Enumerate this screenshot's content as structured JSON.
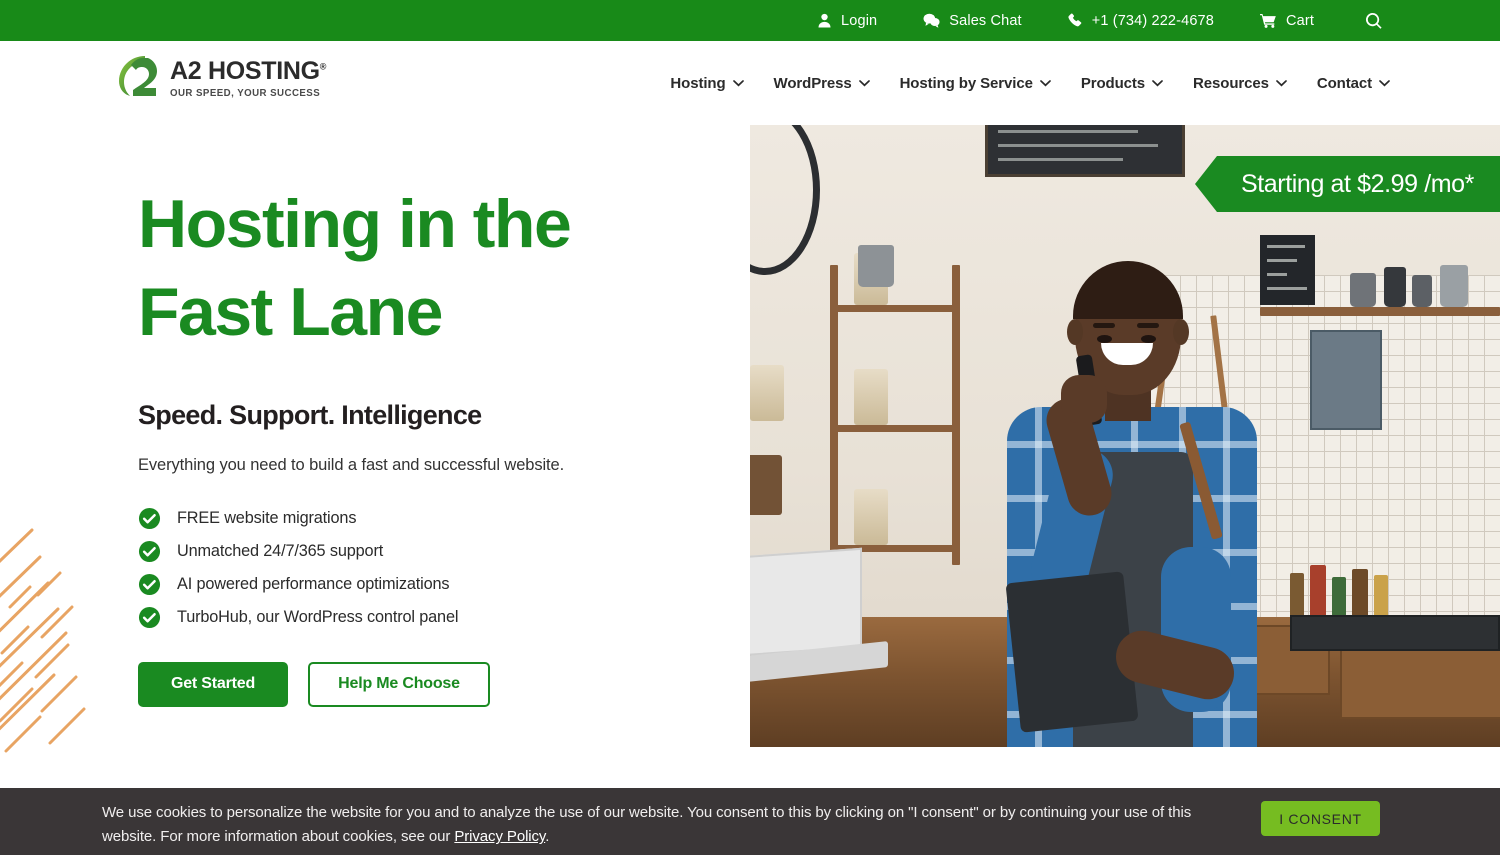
{
  "topbar": {
    "items": [
      {
        "label": "Login",
        "icon": "user-icon"
      },
      {
        "label": "Sales Chat",
        "icon": "chat-icon"
      },
      {
        "label": "+1 (734) 222-4678",
        "icon": "phone-icon"
      },
      {
        "label": "Cart",
        "icon": "cart-icon"
      }
    ],
    "search_icon": "search-icon"
  },
  "logo": {
    "mark": "a2-logo-mark",
    "name_bold": "A2",
    "name_rest": " HOSTING",
    "registered": "®",
    "tagline": "OUR SPEED, YOUR SUCCESS"
  },
  "nav": {
    "items": [
      {
        "label": "Hosting"
      },
      {
        "label": "WordPress"
      },
      {
        "label": "Hosting by Service"
      },
      {
        "label": "Products"
      },
      {
        "label": "Resources"
      },
      {
        "label": "Contact"
      }
    ]
  },
  "hero": {
    "heading_line1": "Hosting in the",
    "heading_line2": "Fast Lane",
    "subheading": "Speed. Support. Intelligence",
    "description": "Everything you need to build a fast and successful website.",
    "features": [
      {
        "label": "FREE website migrations"
      },
      {
        "label": "Unmatched 24/7/365 support"
      },
      {
        "label": "AI powered performance optimizations"
      },
      {
        "label": "TurboHub, our WordPress control panel"
      }
    ],
    "primary_cta": "Get Started",
    "secondary_cta": "Help Me Choose",
    "price_badge": "Starting at $2.99 /mo*",
    "image_alt": "Smiling cafe owner on phone holding tablet behind counter"
  },
  "cookie": {
    "text_before_link": "We use cookies to personalize the website for you and to analyze the use of our website. You consent to this by clicking on \"I consent\" or by continuing your use of this website. For more information about cookies, see our ",
    "link_label": "Privacy Policy",
    "text_after_link": ".",
    "consent_label": "I CONSENT"
  },
  "colors": {
    "brand_green": "#1a8a21",
    "topbar_green": "#188a18",
    "consent_green": "#76bc21",
    "cookie_bg": "#3a3637",
    "accent_orange": "#e8a463"
  }
}
